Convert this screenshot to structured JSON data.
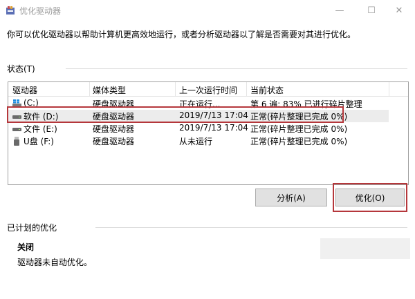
{
  "window": {
    "title": "优化驱动器",
    "minimize": "—",
    "maximize": "☐",
    "close": "✕"
  },
  "intro": "你可以优化驱动器以帮助计算机更高效地运行，或者分析驱动器以了解是否需要对其进行优化。",
  "status": {
    "label": "状态(T)",
    "columns": [
      "驱动器",
      "媒体类型",
      "上一次运行时间",
      "当前状态"
    ],
    "rows": [
      {
        "drive": "(C:)",
        "icon": "windows-drive-icon",
        "media": "硬盘驱动器",
        "last_run": "正在运行...",
        "state": "第 6 遍: 83% 已进行碎片整理"
      },
      {
        "drive": "软件 (D:)",
        "icon": "hard-drive-icon",
        "media": "硬盘驱动器",
        "last_run": "2019/7/13 17:04",
        "state": "正常(碎片整理已完成 0%)",
        "selected": true
      },
      {
        "drive": "文件 (E:)",
        "icon": "hard-drive-icon",
        "media": "硬盘驱动器",
        "last_run": "2019/7/13 17:04",
        "state": "正常(碎片整理已完成 0%)"
      },
      {
        "drive": "U盘 (F:)",
        "icon": "usb-drive-icon",
        "media": "硬盘驱动器",
        "last_run": "从未运行",
        "state": "正常(碎片整理已完成 0%)"
      }
    ]
  },
  "buttons": {
    "analyze": "分析(A)",
    "optimize": "优化(O)"
  },
  "scheduled": {
    "label": "已计划的优化",
    "status": "关闭",
    "description": "驱动器未自动优化。"
  },
  "colors": {
    "highlight": "#b5373b",
    "button_bg": "#e1e1e1",
    "selected_row": "#ececec"
  }
}
